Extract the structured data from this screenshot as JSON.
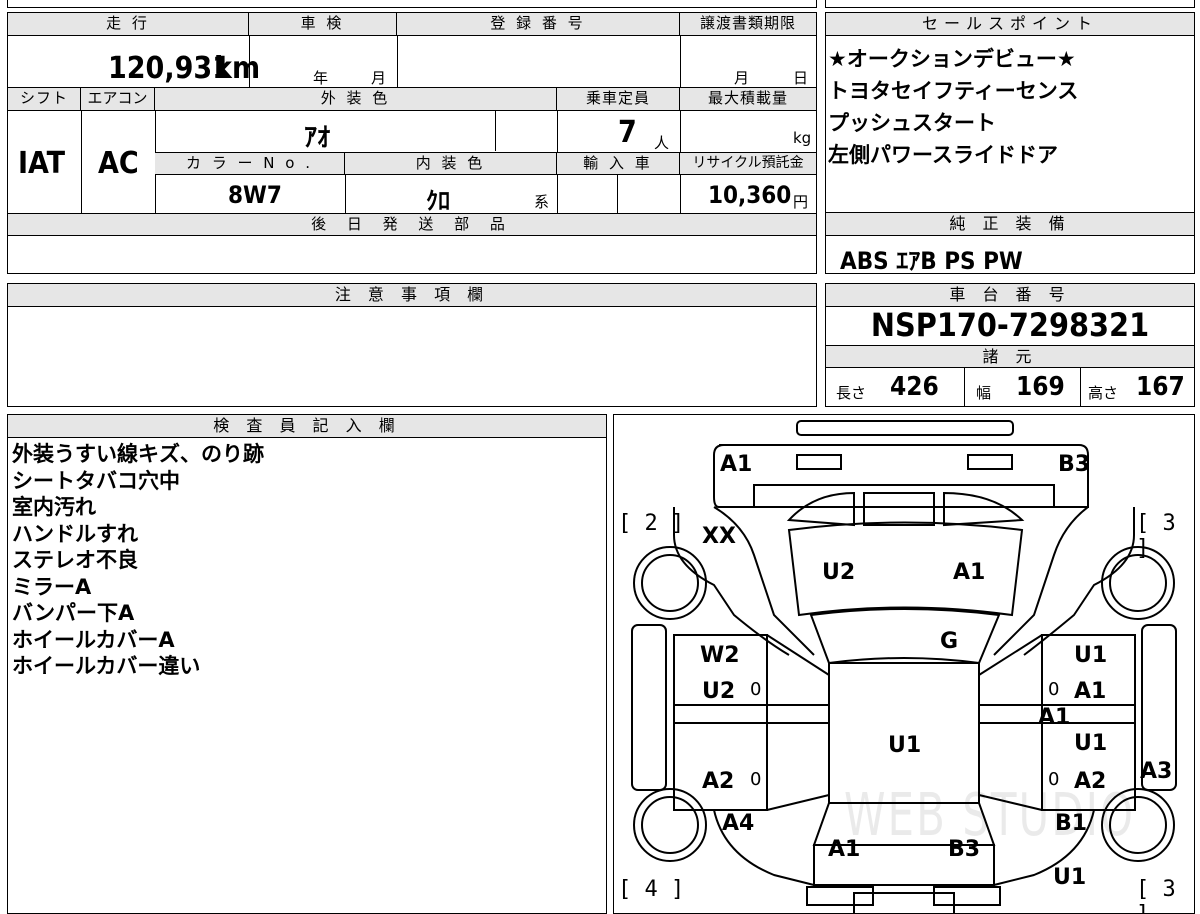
{
  "vehicle": {
    "mileage_label": "走 行",
    "mileage_value": "120,931",
    "mileage_unit": "km",
    "inspection_label": "車 検",
    "inspection_year": "年",
    "inspection_month": "月",
    "reg_label": "登 録 番 号",
    "transfer_label": "譲渡書類期限",
    "transfer_month": "月",
    "transfer_day": "日",
    "shift_label": "シフト",
    "shift_value": "IAT",
    "ac_label": "エアコン",
    "ac_value": "AC",
    "ext_color_label": "外 装 色",
    "ext_color_value": "ｱｵ",
    "capacity_label": "乗車定員",
    "capacity_value": "7",
    "capacity_unit": "人",
    "maxload_label": "最大積載量",
    "maxload_unit": "kg",
    "colorno_label": "カ ラ ー N o .",
    "colorno_value": "8W7",
    "int_color_label": "内 装 色",
    "int_color_value": "ｸﾛ",
    "int_color_suffix": "系",
    "import_label": "輸 入 車",
    "recycle_label": "リサイクル預託金",
    "recycle_value": "10,360",
    "recycle_unit": "円",
    "later_parts_label": "後 日 発 送 部 品"
  },
  "sales_points": {
    "title": "セールスポイント",
    "items": [
      "★オークションデビュー★",
      "トヨタセイフティーセンス",
      "プッシュスタート",
      "左側パワースライドドア"
    ]
  },
  "equipment": {
    "title": "純 正 装 備",
    "value": "ABS ｴｱB PS PW"
  },
  "notes": {
    "title": "注 意 事 項 欄"
  },
  "chassis": {
    "title": "車 台 番 号",
    "value": "NSP170-7298321",
    "spec_title": "諸 元",
    "length_label": "長さ",
    "length_value": "426",
    "width_label": "幅",
    "width_value": "169",
    "height_label": "高さ",
    "height_value": "167"
  },
  "inspector": {
    "title": "検 査 員 記 入 欄",
    "lines": [
      "外装うすい線キズ、のり跡",
      "シートタバコ穴中",
      "室内汚れ",
      "ハンドルすれ",
      "ステレオ不良",
      "ミラーA",
      "バンパー下A",
      "ホイールカバーA",
      "ホイールカバー違い"
    ]
  },
  "diagram": {
    "labels": {
      "front_left": "A1",
      "front_right": "B3",
      "fender_left": "XX",
      "hood_left": "U2",
      "hood_right": "A1",
      "windshield": "G",
      "fdoor_left_1": "W2",
      "fdoor_left_2": "U2",
      "fdoor_right_1": "U1",
      "fdoor_right_2": "A1",
      "pillar_right": "A1",
      "roof": "U1",
      "rdoor_left": "A2",
      "rdoor_right_1": "U1",
      "rdoor_right_2": "A2",
      "side_right": "A3",
      "rear_left_fender": "A4",
      "rear_right_fender": "B1",
      "tail_left": "A1",
      "tail_right": "B3",
      "rear_right_bottom": "U1"
    },
    "tire_markers": {
      "front_left": "[ 2 ]",
      "front_right": "[ 3 ]",
      "rear_left": "[ 4 ]",
      "rear_right": "[ 3 ]"
    },
    "door_marks": [
      "0",
      "0",
      "0",
      "0"
    ],
    "watermark": "WEB STUDIO"
  }
}
